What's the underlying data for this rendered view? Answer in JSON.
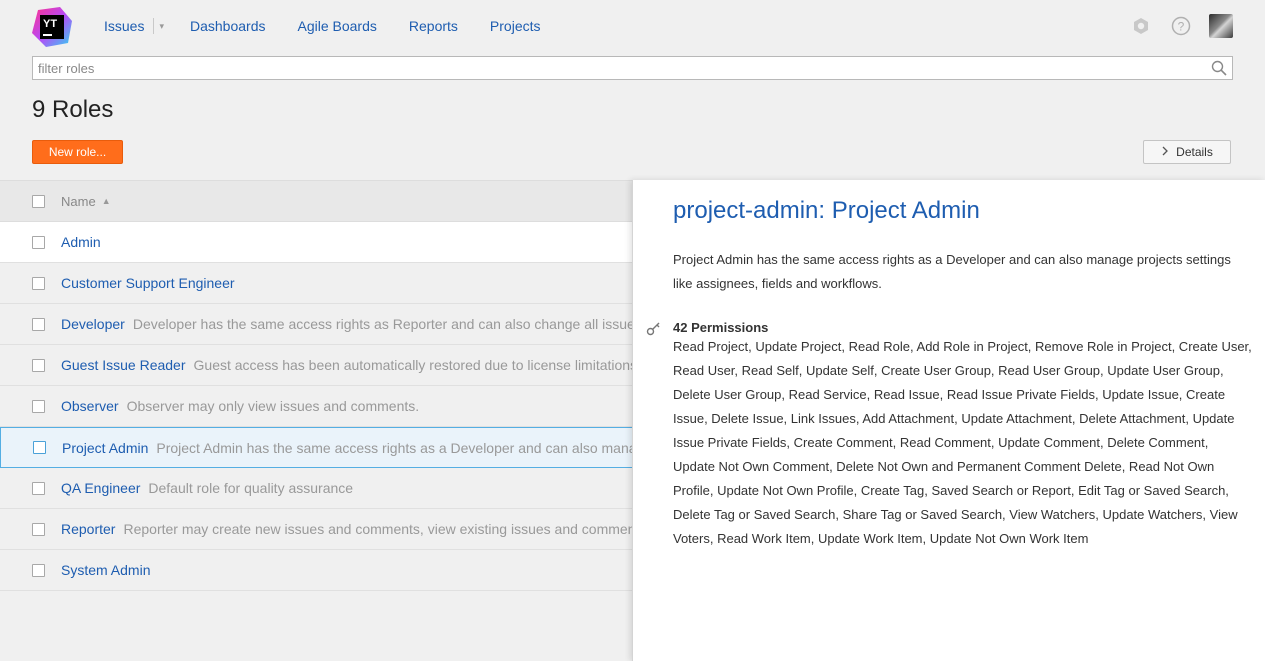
{
  "app": {
    "logo_text": "YT"
  },
  "nav": {
    "issues": "Issues",
    "dashboards": "Dashboards",
    "agile_boards": "Agile Boards",
    "reports": "Reports",
    "projects": "Projects"
  },
  "header_icons": [
    "settings-icon",
    "help-icon",
    "user-avatar"
  ],
  "search": {
    "placeholder": "filter roles",
    "value": ""
  },
  "page": {
    "title": "9 Roles",
    "new_role_label": "New role...",
    "details_label": "Details"
  },
  "table": {
    "column_name": "Name",
    "rows": [
      {
        "name": "Admin",
        "description": ""
      },
      {
        "name": "Customer Support Engineer",
        "description": ""
      },
      {
        "name": "Developer",
        "description": "Developer has the same access rights as Reporter and can also change all issues attributes"
      },
      {
        "name": "Guest Issue Reader",
        "description": "Guest access has been automatically restored due to license limitations"
      },
      {
        "name": "Observer",
        "description": "Observer may only view issues and comments."
      },
      {
        "name": "Project Admin",
        "description": "Project Admin has the same access rights as a Developer and can also manage projects settings like assignees, fields and workflows."
      },
      {
        "name": "QA Engineer",
        "description": "Default role for quality assurance"
      },
      {
        "name": "Reporter",
        "description": "Reporter may create new issues and comments, view existing issues and comments, and"
      },
      {
        "name": "System Admin",
        "description": ""
      }
    ]
  },
  "detail": {
    "title": "project-admin: Project Admin",
    "description": "Project Admin has the same access rights as a Developer and can also manage projects settings like assignees, fields and workflows.",
    "permissions_heading": "42 Permissions",
    "permissions_text": "Read Project, Update Project, Read Role, Add Role in Project, Remove Role in Project, Create User, Read User, Read Self, Update Self, Create User Group, Read User Group, Update User Group, Delete User Group, Read Service, Read Issue, Read Issue Private Fields, Update Issue, Create Issue, Delete Issue, Link Issues, Add Attachment, Update Attachment, Delete Attachment, Update Issue Private Fields, Create Comment, Read Comment, Update Comment, Delete Comment, Update Not Own Comment, Delete Not Own and Permanent Comment Delete, Read Not Own Profile, Update Not Own Profile, Create Tag, Saved Search or Report, Edit Tag or Saved Search, Delete Tag or Saved Search, Share Tag or Saved Search, View Watchers, Update Watchers, View Voters, Read Work Item, Update Work Item, Update Not Own Work Item"
  },
  "colors": {
    "link": "#1e5db0",
    "primary_button": "#ff6d1b",
    "selected_row_border": "#54aee3"
  }
}
